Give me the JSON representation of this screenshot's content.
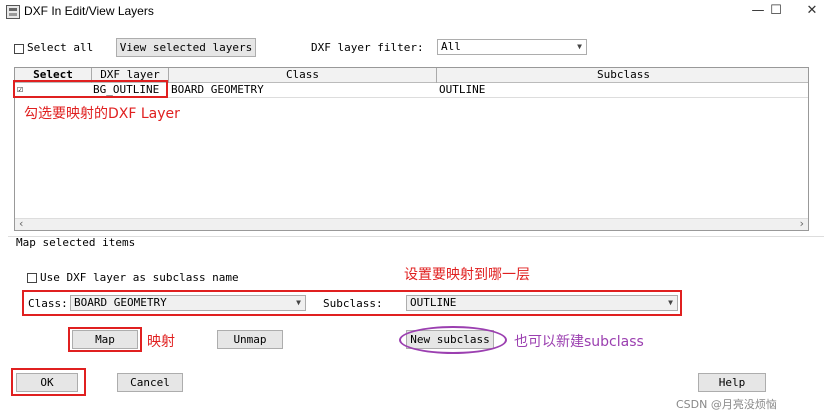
{
  "window": {
    "title": "DXF In Edit/View Layers",
    "minimize": "—",
    "maximize": "☐",
    "close": "✕"
  },
  "toolbar": {
    "select_all_label": "Select all",
    "view_selected_label": "View selected layers",
    "filter_label": "DXF layer filter:",
    "filter_value": "All"
  },
  "table": {
    "columns": [
      "Select",
      "DXF layer",
      "Class",
      "Subclass"
    ],
    "rows": [
      {
        "select": "☑",
        "dxf_layer": "BG_OUTLINE",
        "class": "BOARD GEOMETRY",
        "subclass": "OUTLINE"
      }
    ],
    "scroll_left": "‹",
    "scroll_right": "›"
  },
  "map_section": {
    "title": "Map selected items",
    "use_dxf_label": "Use DXF layer as subclass name",
    "class_label": "Class:",
    "class_value": "BOARD GEOMETRY",
    "subclass_label": "Subclass:",
    "subclass_value": "OUTLINE",
    "map_label": "Map",
    "unmap_label": "Unmap",
    "new_subclass_label": "New subclass"
  },
  "footer": {
    "ok_label": "OK",
    "cancel_label": "Cancel",
    "help_label": "Help"
  },
  "annotations": {
    "select_layer": "勾选要映射的DXF Layer",
    "set_target": "设置要映射到哪一层",
    "map_note": "映射",
    "new_subclass_note": "也可以新建subclass",
    "watermark": "CSDN @月亮没烦恼"
  },
  "colors": {
    "annotation_red": "#e02020",
    "annotation_purple": "#9b3fb0"
  }
}
